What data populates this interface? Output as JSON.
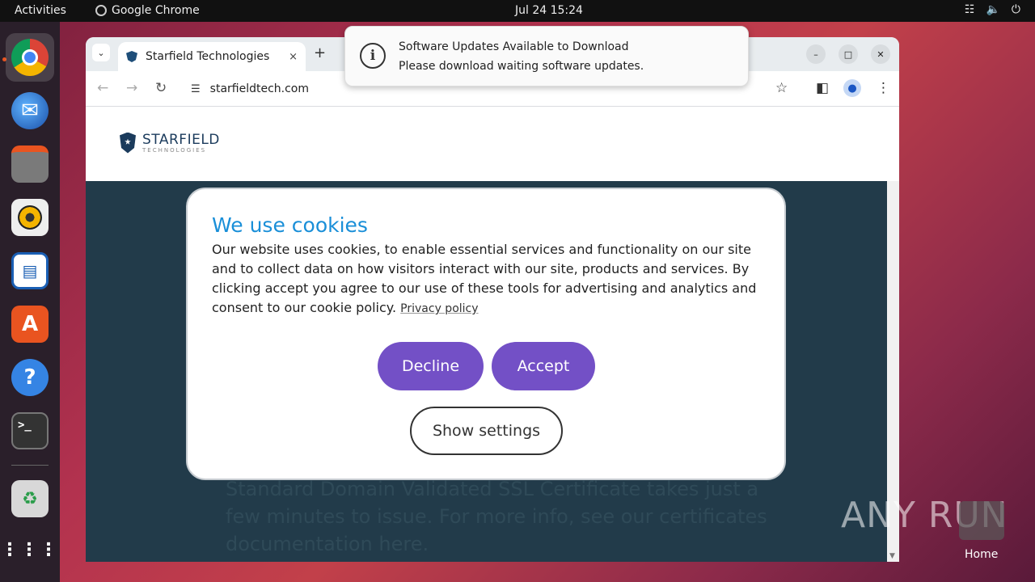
{
  "topbar": {
    "activities": "Activities",
    "app_name": "Google Chrome",
    "clock": "Jul 24  15:24",
    "tray": [
      "network-icon",
      "volume-icon",
      "power-icon"
    ]
  },
  "dock": {
    "items": [
      "chrome-icon",
      "thunderbird-icon",
      "files-icon",
      "rhythmbox-icon",
      "writer-icon",
      "app-center-icon",
      "help-icon",
      "terminal-icon",
      "trash-icon",
      "show-apps-icon"
    ]
  },
  "browser": {
    "tab_title": "Starfield Technologies",
    "tab_close": "×",
    "new_tab": "+",
    "url": "starfieldtech.com"
  },
  "site": {
    "logo_name": "STARFIELD",
    "logo_sub": "TECHNOLOGIES",
    "hero_text": "Standard Domain Validated SSL Certificate takes just a few minutes to issue. For more info, see our certificates documentation here."
  },
  "cookie": {
    "title": "We use cookies",
    "body": "Our website uses cookies, to enable essential services and functionality on our site and to collect data on how visitors interact with our site, products and services. By clicking accept you agree to our use of these tools for advertising and analytics and consent to our cookie policy.",
    "privacy_link": "Privacy policy",
    "decline": "Decline",
    "accept": "Accept",
    "settings": "Show settings"
  },
  "notification": {
    "title": "Software Updates Available to Download",
    "body": "Please download waiting software updates."
  },
  "watermark": "ANY RUN",
  "desktop": {
    "home_label": "Home"
  },
  "colors": {
    "accent_button": "#7350c6",
    "cookie_title": "#1a8fd8",
    "hero_bg": "#223b4a"
  }
}
